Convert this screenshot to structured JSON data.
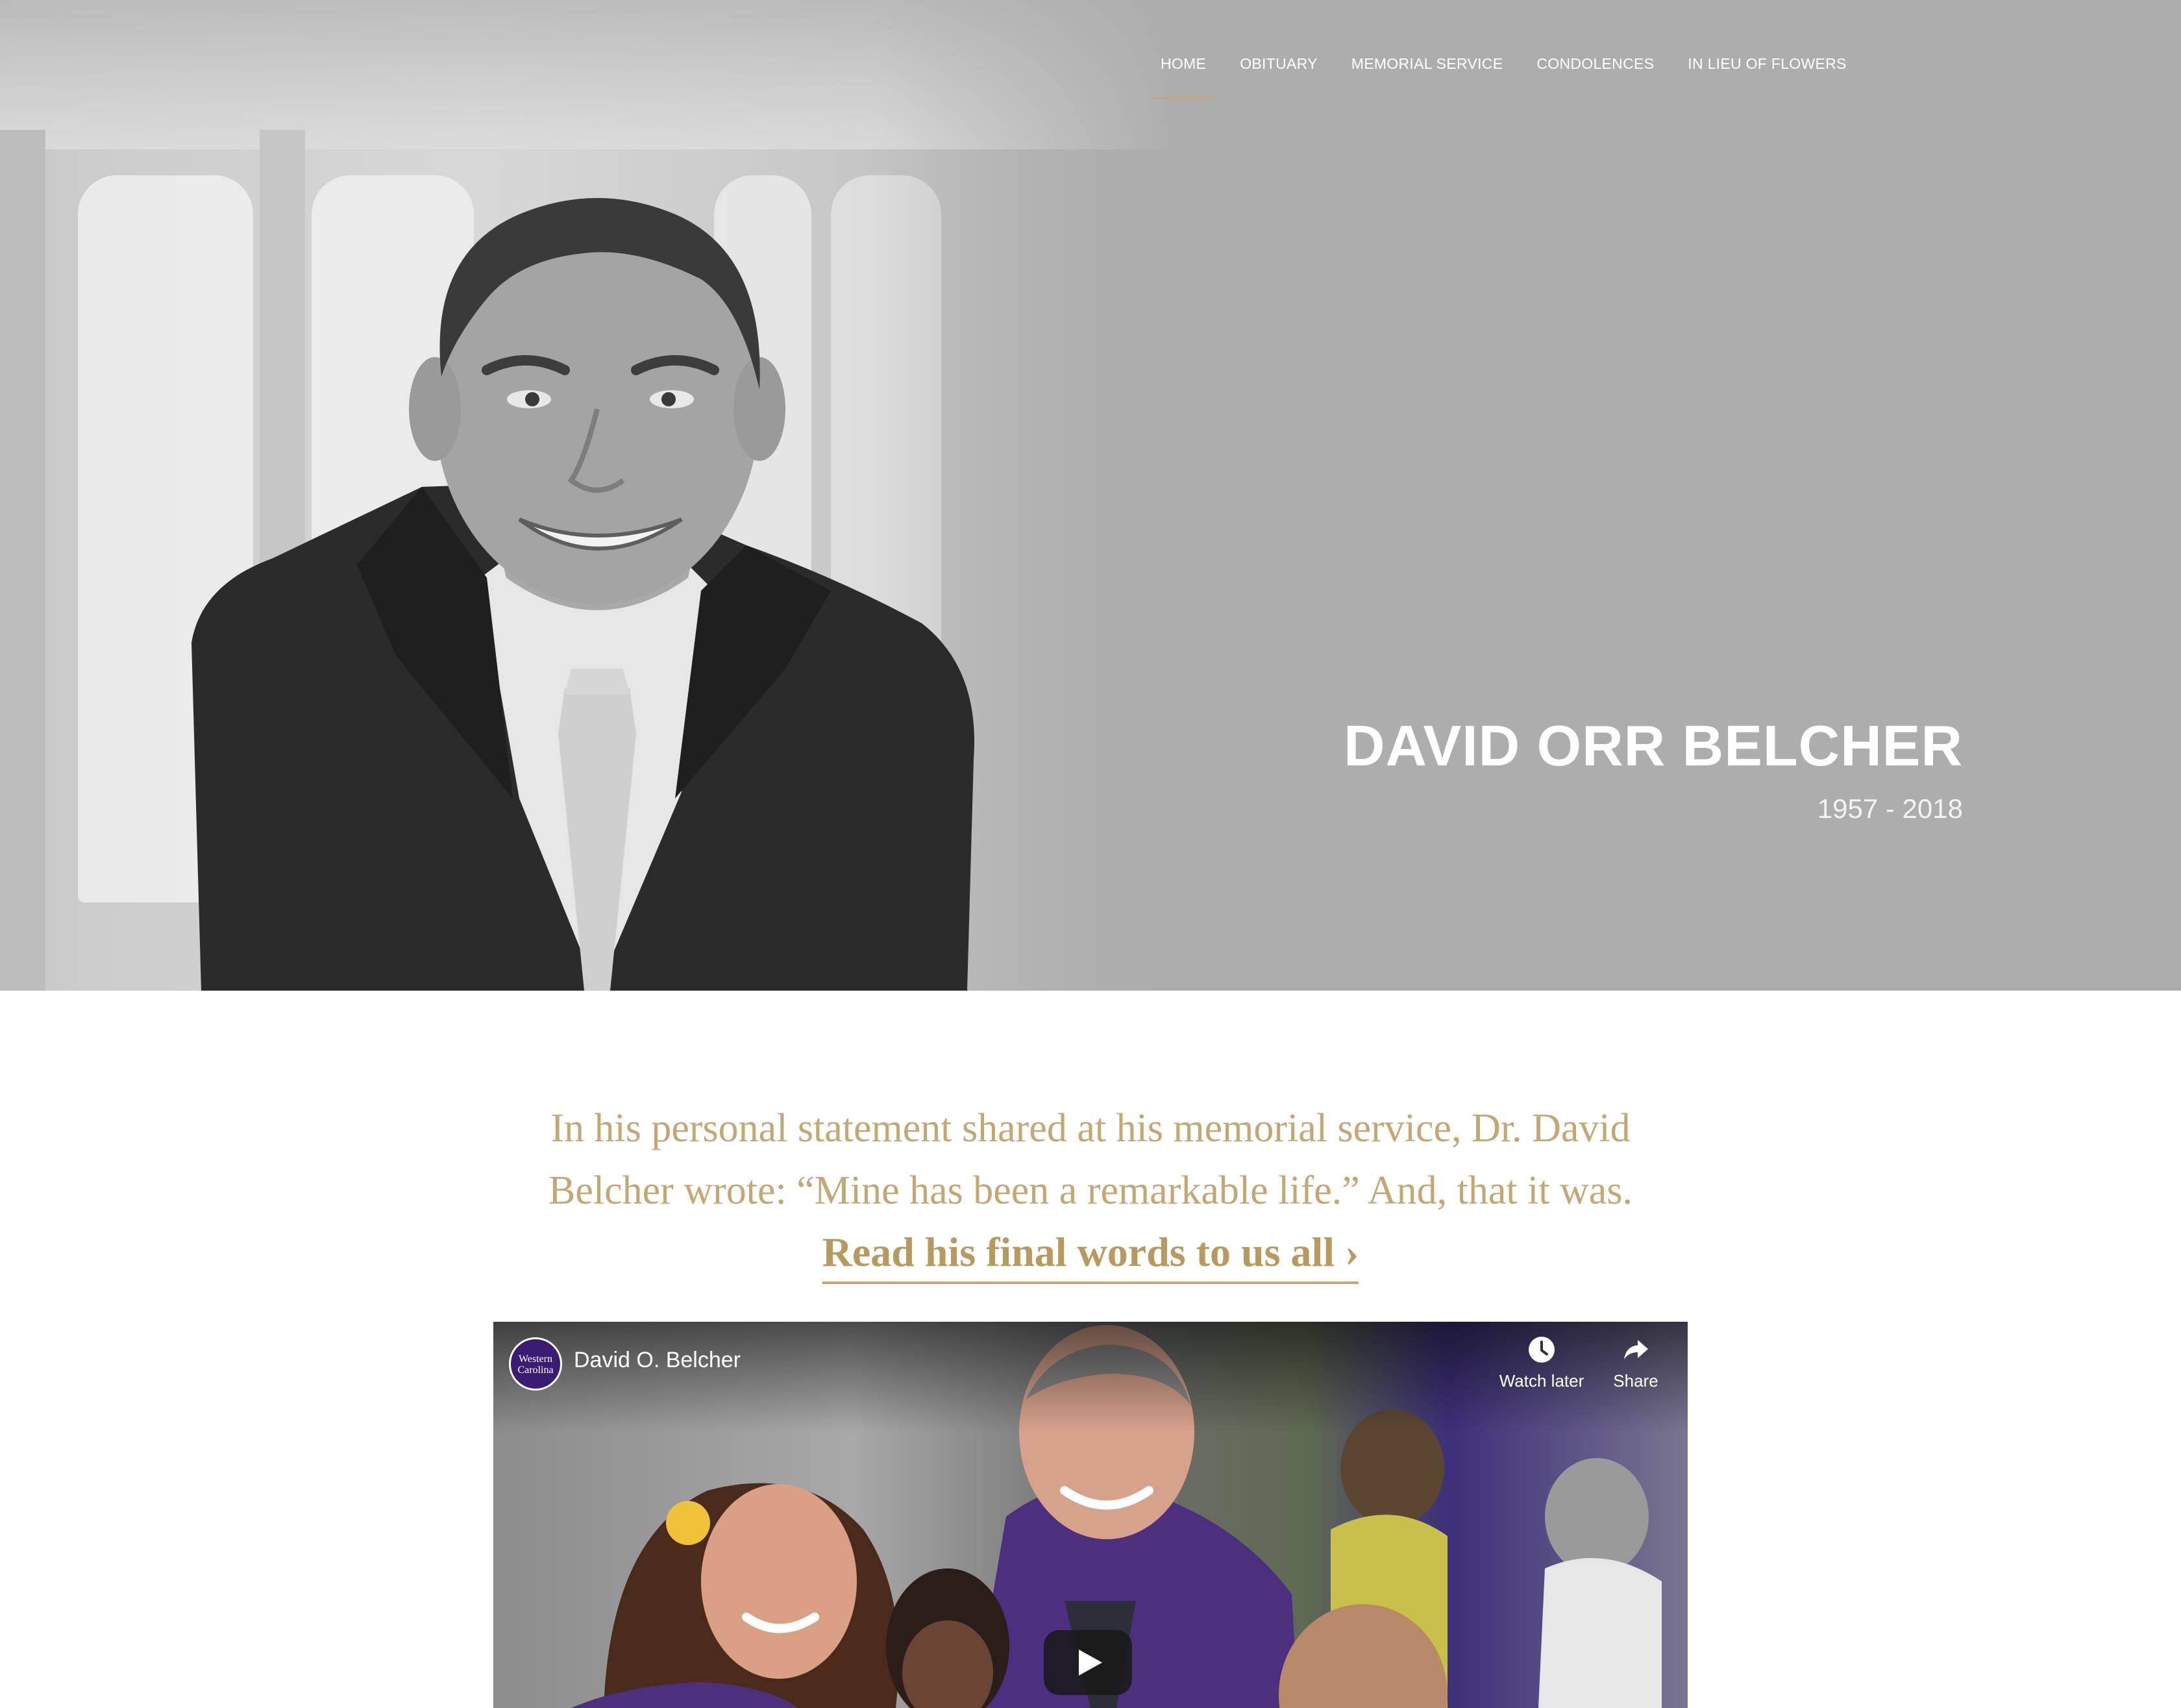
{
  "nav": {
    "items": [
      {
        "label": "HOME",
        "active": true
      },
      {
        "label": "OBITUARY",
        "active": false
      },
      {
        "label": "MEMORIAL SERVICE",
        "active": false
      },
      {
        "label": "CONDOLENCES",
        "active": false
      },
      {
        "label": "IN LIEU OF FLOWERS",
        "active": false
      }
    ]
  },
  "hero": {
    "name": "DAVID ORR BELCHER",
    "dates": "1957 - 2018"
  },
  "quote": {
    "line1": "In his personal statement shared at his memorial service, Dr. David",
    "line2": "Belcher wrote: “Mine has been a remarkable life.” And, that it was.",
    "link_label": "Read his final words to us all ›"
  },
  "video": {
    "title": "David O. Belcher",
    "channel_logo_text": "Western Carolina",
    "watch_later_label": "Watch later",
    "share_label": "Share"
  },
  "colors": {
    "accent_gold": "#c4a772",
    "hero_gray": "#adadad"
  }
}
